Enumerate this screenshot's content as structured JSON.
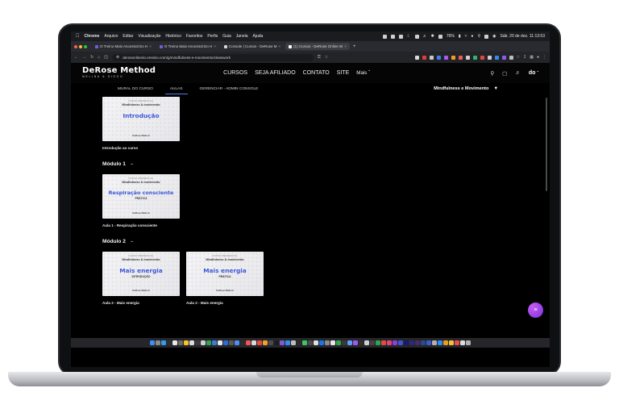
{
  "menubar": {
    "app": "Chrome",
    "items": [
      "Arquivo",
      "Editar",
      "Visualização",
      "Histórico",
      "Favoritos",
      "Perfis",
      "Guia",
      "Janela",
      "Ajuda"
    ],
    "battery": "76%",
    "datetime": "Sáb. 20 de dez.  11:13:53"
  },
  "tabs": [
    {
      "label": "O Treino Mais Ancestral Do H"
    },
    {
      "label": "O Treino Mais Ancestral Do H"
    },
    {
      "label": "Console | Cursos - DeRose M"
    },
    {
      "label": "(1) Cursos - DeRose Online W"
    }
  ],
  "addressbar": {
    "url": "derosonlinerio.ensinio.com/g/mindfulness-e-movimento/classwork"
  },
  "site": {
    "logo": "DeRose Method",
    "logo_sub": "MELINA & DIEGO",
    "nav": [
      "CURSOS",
      "SEJA AFILIADO",
      "CONTATO",
      "SITE"
    ],
    "nav_more": "Mais",
    "avatar": "do"
  },
  "subnav": {
    "tabs": [
      "MURAL DO CURSO",
      "AULAS",
      "GERENCIAR - ADMIN CONSOLE"
    ],
    "active": "AULAS",
    "course": "Mindfulness e Movimento"
  },
  "cards": {
    "course_small": "CURSO PRESENCIAL",
    "course_sub": "Mindfulness & movimento",
    "brand": "DeRose Method",
    "intro": {
      "title": "Introdução",
      "label": "Introdução ao curso"
    },
    "m1": {
      "title": "Respiração consciente",
      "tag": "PRÁTICA",
      "label": "Aula 1 - Respiração consciente"
    },
    "m2a": {
      "title": "Mais energia",
      "tag": "INTRODUÇÃO",
      "label": "Aula 2 - Mais energia"
    },
    "m2b": {
      "title": "Mais energia",
      "tag": "PRÁTICA",
      "label": "Aula 2 - Mais energia"
    }
  },
  "modules": {
    "m1": "Módulo 1",
    "m2": "Módulo 2"
  }
}
